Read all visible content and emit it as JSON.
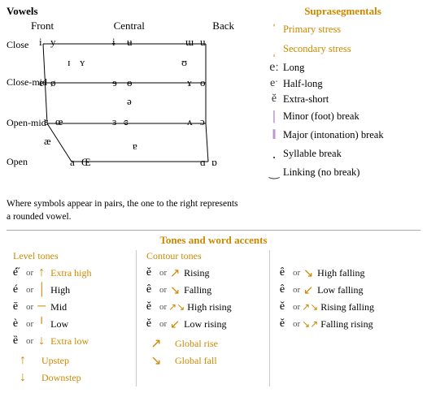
{
  "vowels": {
    "title": "Vowels",
    "col_labels": [
      "Front",
      "Central",
      "Back"
    ],
    "row_labels": [
      "Close",
      "Close-mid",
      "Open-mid",
      "Open"
    ],
    "note": "Where symbols appear in pairs, the one to the right represents a rounded vowel."
  },
  "suprasegmentals": {
    "title": "Suprasegmentals",
    "items": [
      {
        "symbol": "ˈ",
        "label": "Primary stress"
      },
      {
        "symbol": "ˌ",
        "label": "Secondary stress"
      },
      {
        "symbol": "eː",
        "label": "Long"
      },
      {
        "symbol": "eˑ",
        "label": "Half-long"
      },
      {
        "symbol": "ĕ",
        "label": "Extra-short"
      },
      {
        "symbol": "|",
        "label": "Minor (foot) break"
      },
      {
        "symbol": "‖",
        "label": "Major (intonation) break"
      },
      {
        "symbol": ".",
        "label": "Syllable break"
      },
      {
        "symbol": "‿",
        "label": "Linking (no break)"
      }
    ]
  },
  "tones": {
    "title": "Tones and word accents",
    "level_title": "Level tones",
    "contour_title": "Contour tones",
    "level": [
      {
        "char": "é̋",
        "diacritic": "↑",
        "name": "Extra high"
      },
      {
        "char": "é",
        "diacritic": "│",
        "name": "High"
      },
      {
        "char": "ē",
        "diacritic": "─",
        "name": "Mid"
      },
      {
        "char": "è",
        "diacritic": "│",
        "name": "Low"
      },
      {
        "char": "ȅ",
        "diacritic": "↓",
        "name": "Extra low"
      }
    ],
    "level_extra": [
      {
        "diacritic": "↑",
        "name": "Upstep"
      },
      {
        "diacritic": "↓",
        "name": "Downstep"
      }
    ],
    "contour": [
      {
        "char": "ě",
        "diacritic": "↗",
        "name": "Rising"
      },
      {
        "char": "ê",
        "diacritic": "↘",
        "name": "Falling"
      },
      {
        "char": "ě",
        "diacritic": "↗↘",
        "name": "High rising"
      },
      {
        "char": "ě",
        "diacritic": "↙",
        "name": "Low rising"
      },
      {
        "char": "",
        "diacritic": "↗",
        "name": "Global rise"
      },
      {
        "char": "",
        "diacritic": "↘",
        "name": "Global fall"
      }
    ],
    "contour_right": [
      {
        "char": "ê",
        "diacritic": "↘",
        "name": "High falling"
      },
      {
        "char": "ê",
        "diacritic": "↙",
        "name": "Low falling"
      },
      {
        "char": "ě",
        "diacritic": "↗↘",
        "name": "Rising falling"
      },
      {
        "char": "ě",
        "diacritic": "↘↗",
        "name": "Falling rising"
      },
      {
        "char": "",
        "diacritic": "↗",
        "name": "Global rise"
      },
      {
        "char": "",
        "diacritic": "↘",
        "name": "Global fall"
      }
    ]
  }
}
